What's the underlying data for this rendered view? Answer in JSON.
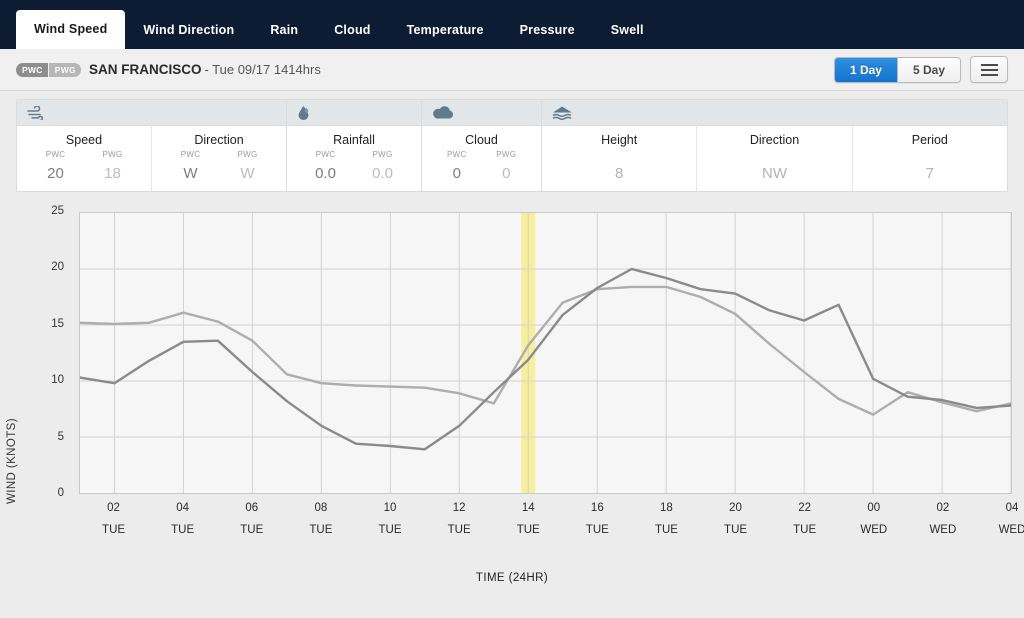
{
  "nav": {
    "tabs": [
      {
        "label": "Wind Speed",
        "active": true
      },
      {
        "label": "Wind Direction",
        "active": false
      },
      {
        "label": "Rain",
        "active": false
      },
      {
        "label": "Cloud",
        "active": false
      },
      {
        "label": "Temperature",
        "active": false
      },
      {
        "label": "Pressure",
        "active": false
      },
      {
        "label": "Swell",
        "active": false
      }
    ]
  },
  "locbar": {
    "badge_pwc": "PWC",
    "badge_pwg": "PWG",
    "location": "SAN FRANCISCO",
    "date": "- Tue 09/17 1414hrs",
    "range_1day": "1 Day",
    "range_5day": "5 Day",
    "active_range": "1 Day",
    "menu_icon": "hamburger-icon"
  },
  "summary": {
    "groups": [
      {
        "icon": "wind-icon",
        "columns": [
          {
            "title": "Speed",
            "subs": [
              "PWC",
              "PWG"
            ],
            "values": [
              "20",
              "18"
            ]
          },
          {
            "title": "Direction",
            "subs": [
              "PWC",
              "PWG"
            ],
            "values": [
              "W",
              "W"
            ]
          }
        ]
      },
      {
        "icon": "rain-drop-icon",
        "columns": [
          {
            "title": "Rainfall",
            "subs": [
              "PWC",
              "PWG"
            ],
            "values": [
              "0.0",
              "0.0"
            ]
          }
        ]
      },
      {
        "icon": "cloud-icon",
        "columns": [
          {
            "title": "Cloud",
            "subs": [
              "PWC",
              "PWG"
            ],
            "values": [
              "0",
              "0"
            ]
          }
        ]
      },
      {
        "icon": "swell-wave-icon",
        "columns": [
          {
            "title": "Height",
            "subs": [],
            "values": [
              "8"
            ]
          },
          {
            "title": "Direction",
            "subs": [],
            "values": [
              "NW"
            ]
          },
          {
            "title": "Period",
            "subs": [],
            "values": [
              "7"
            ]
          }
        ]
      }
    ]
  },
  "chart_data": {
    "type": "line",
    "title": "",
    "xlabel": "TIME (24HR)",
    "ylabel": "WIND (KNOTS)",
    "ylim": [
      0,
      25
    ],
    "yticks": [
      25,
      20,
      15,
      10,
      5,
      0
    ],
    "grid": true,
    "legend_position": "none",
    "highlight_band": {
      "x_label": "14",
      "day": "TUE",
      "color": "#f7ef9a",
      "note": "current time 1414hrs"
    },
    "x_labels": [
      {
        "hh": "02",
        "dd": "TUE"
      },
      {
        "hh": "04",
        "dd": "TUE"
      },
      {
        "hh": "06",
        "dd": "TUE"
      },
      {
        "hh": "08",
        "dd": "TUE"
      },
      {
        "hh": "10",
        "dd": "TUE"
      },
      {
        "hh": "12",
        "dd": "TUE"
      },
      {
        "hh": "14",
        "dd": "TUE"
      },
      {
        "hh": "16",
        "dd": "TUE"
      },
      {
        "hh": "18",
        "dd": "TUE"
      },
      {
        "hh": "20",
        "dd": "TUE"
      },
      {
        "hh": "22",
        "dd": "TUE"
      },
      {
        "hh": "00",
        "dd": "WED"
      },
      {
        "hh": "02",
        "dd": "WED"
      },
      {
        "hh": "04",
        "dd": "WED"
      }
    ],
    "x": [
      1,
      2,
      3,
      4,
      5,
      6,
      7,
      8,
      9,
      10,
      11,
      12,
      13,
      14,
      15,
      16,
      17,
      18,
      19,
      20,
      21,
      22,
      23,
      24,
      25,
      26,
      27,
      28
    ],
    "series": [
      {
        "name": "PWG",
        "color": "#adadad",
        "values": [
          15.2,
          15.1,
          15.2,
          16.1,
          15.3,
          13.6,
          10.6,
          9.8,
          9.6,
          9.5,
          9.4,
          8.9,
          8.0,
          13.2,
          17.0,
          18.2,
          18.4,
          18.4,
          17.5,
          16.0,
          13.3,
          10.8,
          8.4,
          7.0,
          9.0,
          8.1,
          7.3,
          8.0
        ]
      },
      {
        "name": "PWC",
        "color": "#8a8a8a",
        "values": [
          10.3,
          9.8,
          11.8,
          13.5,
          13.6,
          10.8,
          8.2,
          6.0,
          4.4,
          4.2,
          3.9,
          6.0,
          9.0,
          11.9,
          15.9,
          18.3,
          20.0,
          19.2,
          18.2,
          17.8,
          16.3,
          15.4,
          16.8,
          10.2,
          8.6,
          8.3,
          7.6,
          7.8
        ]
      }
    ]
  }
}
